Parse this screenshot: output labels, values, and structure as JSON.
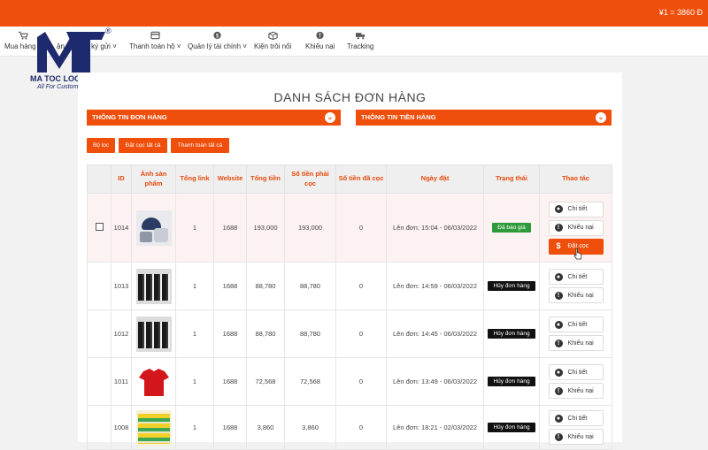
{
  "topbar": {
    "rate": "¥1 = 3860 Đ",
    "color": "#f04e0b"
  },
  "logo": {
    "name": "MA TOC LOGISTICS",
    "tagline": "All For Customers!",
    "registered": "®"
  },
  "nav": [
    {
      "label": "Mua hàng h",
      "icon": "cart-icon"
    },
    {
      "label": "ận chuyển ký gửi",
      "icon": "truck-icon",
      "chevron": "˅"
    },
    {
      "label": "Thanh toán hộ",
      "icon": "card-icon",
      "chevron": "˅"
    },
    {
      "label": "Quản lý tài chính",
      "icon": "dollar-icon",
      "chevron": "˅"
    },
    {
      "label": "Kiện trôi nổi",
      "icon": "box-icon"
    },
    {
      "label": "Khiếu nại",
      "icon": "alert-icon"
    },
    {
      "label": "Tracking",
      "icon": "truck-icon"
    }
  ],
  "page": {
    "title": "DANH SÁCH ĐƠN HÀNG",
    "accordion_order": "THÔNG TIN ĐƠN HÀNG",
    "accordion_money": "THÔNG TIN TIỀN HÀNG",
    "filter_button": "Bộ lọc",
    "deposit_all_button": "Đặt cọc tất cả",
    "pay_all_button": "Thanh toán tất cả"
  },
  "table": {
    "headers": {
      "id": "ID",
      "image": "Ảnh sản phẩm",
      "total_link": "Tổng link",
      "website": "Website",
      "total": "Tổng tiền",
      "deposit_due": "Số tiền phải cọc",
      "deposited": "Số tiền đã cọc",
      "date": "Ngày đặt",
      "status": "Trạng thái",
      "actions": "Thao tác"
    },
    "rows": [
      {
        "id": "1014",
        "links": "1",
        "website": "1688",
        "total": "193,000",
        "due": "193,000",
        "paid": "0",
        "date": "Lên đơn: 15:04 - 06/03/2022",
        "status": "Đã báo giá",
        "status_color": "#2e9a3a",
        "thumb": "hat-bag-thumbnail"
      },
      {
        "id": "1013",
        "links": "1",
        "website": "1688",
        "total": "88,780",
        "due": "88,780",
        "paid": "0",
        "date": "Lên đơn: 14:59 - 06/03/2022",
        "status": "Hủy đơn hàng",
        "status_color": "#111111",
        "thumb": "shirts-thumbnail"
      },
      {
        "id": "1012",
        "links": "1",
        "website": "1688",
        "total": "88,780",
        "due": "88,780",
        "paid": "0",
        "date": "Lên đơn: 14:45 - 06/03/2022",
        "status": "Hủy đơn hàng",
        "status_color": "#111111",
        "thumb": "shirts-thumbnail"
      },
      {
        "id": "1011",
        "links": "1",
        "website": "1688",
        "total": "72,568",
        "due": "72,568",
        "paid": "0",
        "date": "Lên đơn: 13:49 - 06/03/2022",
        "status": "Hủy đơn hàng",
        "status_color": "#111111",
        "thumb": "red-shirt-thumbnail"
      },
      {
        "id": "1008",
        "links": "1",
        "website": "1688",
        "total": "3,860",
        "due": "3,860",
        "paid": "0",
        "date": "Lên đơn: 18:21 - 02/03/2022",
        "status": "Hủy đơn hàng",
        "status_color": "#111111",
        "thumb": "sponge-thumbnail"
      }
    ],
    "actions": {
      "detail": "Chi tiết",
      "complaint": "Khiếu nại",
      "deposit": "Đặt cọc"
    }
  },
  "colors": {
    "accent": "#f04e0b",
    "header_text": "#e64a0c",
    "highlight_row": "#fdf2f2"
  }
}
